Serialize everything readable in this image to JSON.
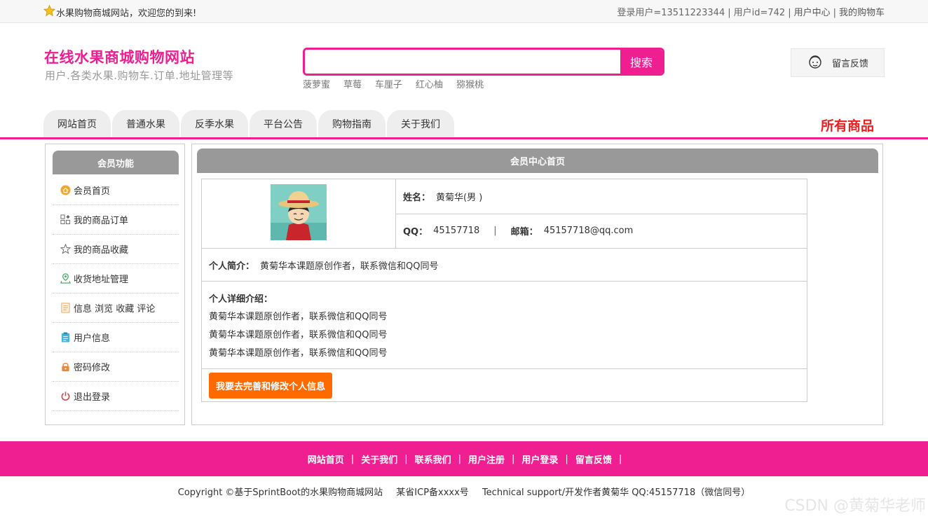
{
  "topbar": {
    "welcome": "水果购物商城网站，欢迎您的到来!",
    "user_login": "登录用户=13511223344",
    "user_id": "用户id=742",
    "user_center": "用户中心",
    "cart": "我的购物车",
    "separator": "|"
  },
  "header": {
    "title": "在线水果商城购物网站",
    "subtitle": "用户.各类水果.购物车.订单.地址管理等",
    "search_button": "搜索",
    "search_value": "",
    "hotwords": [
      "菠萝蜜",
      "草莓",
      "车厘子",
      "红心柚",
      "猕猴桃"
    ],
    "feedback": "留言反馈"
  },
  "nav": {
    "tabs": [
      "网站首页",
      "普通水果",
      "反季水果",
      "平台公告",
      "购物指南",
      "关于我们"
    ],
    "all_goods": "所有商品"
  },
  "sidebar": {
    "title": "会员功能",
    "items": [
      {
        "label": "会员首页",
        "icon": "home-icon"
      },
      {
        "label": "我的商品订单",
        "icon": "orders-icon"
      },
      {
        "label": "我的商品收藏",
        "icon": "star-icon"
      },
      {
        "label": "收货地址管理",
        "icon": "location-icon"
      },
      {
        "label": "信息 浏览 收藏 评论",
        "icon": "document-icon"
      },
      {
        "label": "用户信息",
        "icon": "clipboard-icon"
      },
      {
        "label": "密码修改",
        "icon": "lock-icon"
      },
      {
        "label": "退出登录",
        "icon": "power-icon"
      }
    ]
  },
  "main": {
    "title": "会员中心首页",
    "name_label": "姓名：",
    "name_value": "黄菊华(男 )",
    "qq_label": "QQ：",
    "qq_value": "45157718",
    "divider": "|",
    "email_label": "邮箱：",
    "email_value": "45157718@qq.com",
    "intro_label": "个人简介：",
    "intro_value": "黄菊华本课题原创作者，联系微信和QQ同号",
    "detail_label": "个人详细介绍：",
    "detail_lines": [
      "黄菊华本课题原创作者，联系微信和QQ同号",
      "黄菊华本课题原创作者，联系微信和QQ同号",
      "黄菊华本课题原创作者，联系微信和QQ同号"
    ],
    "edit_button": "我要去完善和修改个人信息"
  },
  "footer": {
    "links": [
      "网站首页",
      "关于我们",
      "联系我们",
      "用户注册",
      "用户登录",
      "留言反馈"
    ],
    "separator": "|",
    "copyright": "Copyright ©基于SprintBoot的水果购物商城网站",
    "icp": "某省ICP备xxxx号",
    "support": "Technical support/开发作者黄菊华 QQ:45157718（微信同号）"
  },
  "watermark": "CSDN @黄菊华老师",
  "colors": {
    "brand_pink": "#ef1e91",
    "accent_red": "#ef1e1e",
    "button_orange": "#ff6a00",
    "panel_header_gray": "#999999"
  }
}
